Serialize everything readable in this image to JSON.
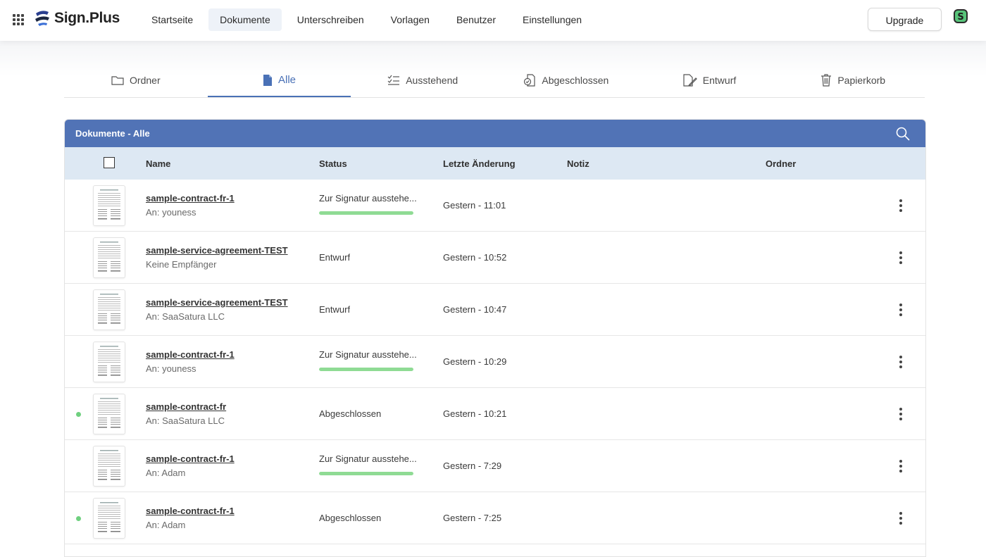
{
  "app": {
    "logo_text": "Sign.Plus",
    "brand_color": "#5173b6"
  },
  "nav": {
    "items": [
      {
        "label": "Startseite"
      },
      {
        "label": "Dokumente",
        "active": true
      },
      {
        "label": "Unterschreiben"
      },
      {
        "label": "Vorlagen"
      },
      {
        "label": "Benutzer"
      },
      {
        "label": "Einstellungen"
      }
    ],
    "upgrade_label": "Upgrade"
  },
  "tabs": [
    {
      "label": "Ordner",
      "icon": "folder-icon"
    },
    {
      "label": "Alle",
      "icon": "document-icon",
      "active": true
    },
    {
      "label": "Ausstehend",
      "icon": "checklist-icon"
    },
    {
      "label": "Abgeschlossen",
      "icon": "completed-document-icon"
    },
    {
      "label": "Entwurf",
      "icon": "draft-icon"
    },
    {
      "label": "Papierkorb",
      "icon": "trash-icon"
    }
  ],
  "table": {
    "title": "Dokumente - Alle",
    "columns": {
      "name": "Name",
      "status": "Status",
      "modified": "Letzte Änderung",
      "note": "Notiz",
      "folder": "Ordner"
    },
    "rows": [
      {
        "name": "sample-contract-fr-1",
        "recipient": "An: youness",
        "status": "Zur Signatur ausstehe...",
        "pending": true,
        "modified": "Gestern - 11:01",
        "unread": false
      },
      {
        "name": "sample-service-agreement-TEST",
        "recipient": "Keine Empfänger",
        "status": "Entwurf",
        "pending": false,
        "modified": "Gestern - 10:52",
        "unread": false
      },
      {
        "name": "sample-service-agreement-TEST",
        "recipient": "An: SaaSatura LLC",
        "status": "Entwurf",
        "pending": false,
        "modified": "Gestern - 10:47",
        "unread": false
      },
      {
        "name": "sample-contract-fr-1",
        "recipient": "An: youness",
        "status": "Zur Signatur ausstehe...",
        "pending": true,
        "modified": "Gestern - 10:29",
        "unread": false
      },
      {
        "name": "sample-contract-fr",
        "recipient": "An: SaaSatura LLC",
        "status": "Abgeschlossen",
        "pending": false,
        "modified": "Gestern - 10:21",
        "unread": true
      },
      {
        "name": "sample-contract-fr-1",
        "recipient": "An: Adam",
        "status": "Zur Signatur ausstehe...",
        "pending": true,
        "modified": "Gestern - 7:29",
        "unread": false
      },
      {
        "name": "sample-contract-fr-1",
        "recipient": "An: Adam",
        "status": "Abgeschlossen",
        "pending": false,
        "modified": "Gestern - 7:25",
        "unread": true
      }
    ]
  }
}
